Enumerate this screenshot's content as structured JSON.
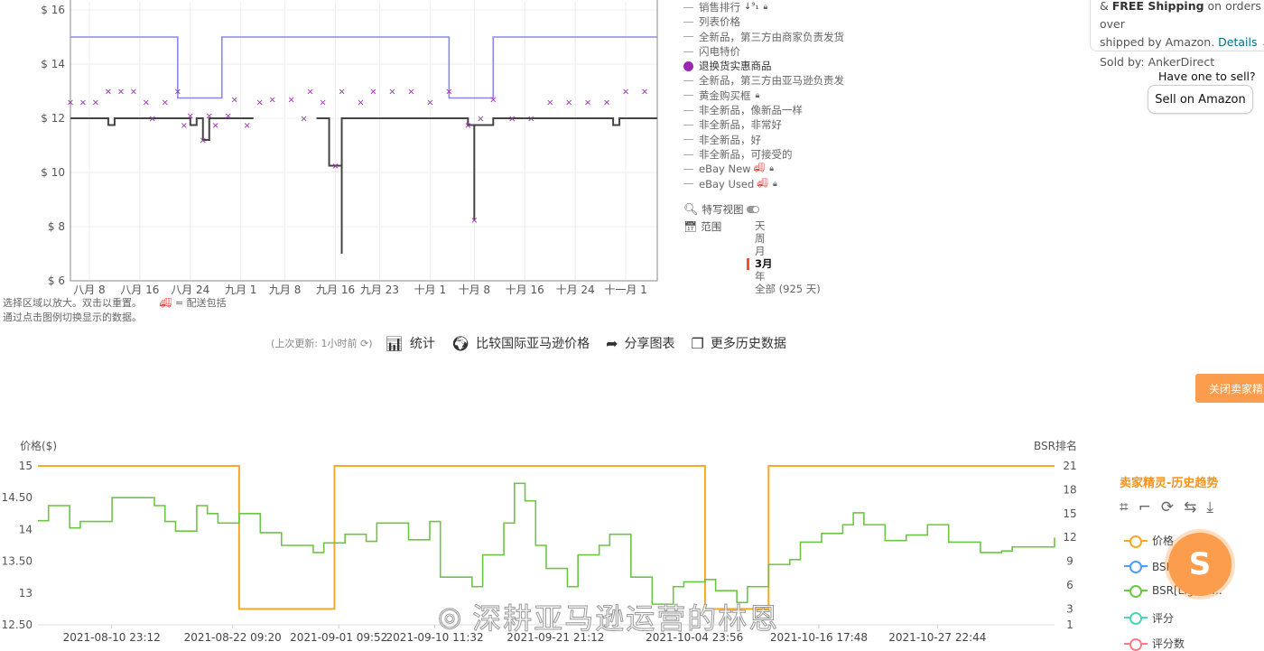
{
  "top_chart": {
    "y_ticks": [
      "$ 16",
      "$ 14",
      "$ 12",
      "$ 10",
      "$ 8",
      "$ 6"
    ],
    "y_values": [
      16,
      14,
      12,
      10,
      8,
      6
    ],
    "x_ticks": [
      {
        "label": "八月 8",
        "date": "2021-08-08"
      },
      {
        "label": "八月 16",
        "date": "2021-08-16"
      },
      {
        "label": "八月 24",
        "date": "2021-08-24"
      },
      {
        "label": "九月 1",
        "date": "2021-09-01"
      },
      {
        "label": "九月 8",
        "date": "2021-09-08"
      },
      {
        "label": "九月 16",
        "date": "2021-09-16"
      },
      {
        "label": "九月 23",
        "date": "2021-09-23"
      },
      {
        "label": "十月 1",
        "date": "2021-10-01"
      },
      {
        "label": "十月 8",
        "date": "2021-10-08"
      },
      {
        "label": "十月 16",
        "date": "2021-10-16"
      },
      {
        "label": "十月 24",
        "date": "2021-10-24"
      },
      {
        "label": "十一月 1",
        "date": "2021-11-01"
      }
    ],
    "x_range": [
      "2021-08-05",
      "2021-11-06"
    ],
    "y_range": [
      6,
      16.3
    ],
    "colors": {
      "list_price": "#8888ee",
      "amazon": "#444444",
      "warehouse": "#9c27b0"
    }
  },
  "chart_data": [
    {
      "type": "line",
      "xlabel": "",
      "ylabel": "",
      "ylim": [
        6,
        16.3
      ],
      "series": [
        {
          "name": "列表价格",
          "step": true,
          "points": [
            [
              "2021-08-05",
              15
            ],
            [
              "2021-08-22",
              12.75
            ],
            [
              "2021-08-29",
              15
            ],
            [
              "2021-10-04",
              12.75
            ],
            [
              "2021-10-11",
              15
            ],
            [
              "2021-11-06",
              15
            ]
          ]
        },
        {
          "step": true,
          "points": [
            [
              "2021-08-05",
              12
            ],
            [
              "2021-08-11",
              11.75
            ],
            [
              "2021-08-12",
              12
            ],
            [
              "2021-08-24",
              11.75
            ],
            [
              "2021-08-25",
              12
            ],
            [
              "2021-08-26",
              11.2
            ],
            [
              "2021-08-27",
              12
            ],
            [
              "2021-09-03",
              12
            ],
            [
              "2021-09-13",
              null
            ],
            [
              "2021-09-13",
              12
            ],
            [
              "2021-09-15",
              10.25
            ],
            [
              "2021-09-17",
              7
            ],
            [
              "2021-09-17",
              12
            ],
            [
              "2021-09-20",
              12
            ],
            [
              "2021-10-06",
              12
            ],
            [
              "2021-10-07",
              11.75
            ],
            [
              "2021-10-08",
              8.25
            ],
            [
              "2021-10-08",
              11.75
            ],
            [
              "2021-10-11",
              12
            ],
            [
              "2021-10-29",
              12
            ],
            [
              "2021-10-30",
              11.75
            ],
            [
              "2021-10-31",
              12
            ],
            [
              "2021-11-06",
              12
            ]
          ]
        },
        {
          "name": "退换货实惠商品",
          "marker": "x",
          "points": [
            [
              "2021-08-05",
              12.6
            ],
            [
              "2021-08-07",
              12.6
            ],
            [
              "2021-08-09",
              12.6
            ],
            [
              "2021-08-11",
              13
            ],
            [
              "2021-08-13",
              13
            ],
            [
              "2021-08-15",
              13
            ],
            [
              "2021-08-17",
              12.6
            ],
            [
              "2021-08-18",
              12
            ],
            [
              "2021-08-20",
              12.6
            ],
            [
              "2021-08-22",
              13
            ],
            [
              "2021-08-23",
              11.75
            ],
            [
              "2021-08-24",
              12.1
            ],
            [
              "2021-08-26",
              11.2
            ],
            [
              "2021-08-27",
              12.1
            ],
            [
              "2021-08-28",
              11.75
            ],
            [
              "2021-08-30",
              12.1
            ],
            [
              "2021-08-31",
              12.7
            ],
            [
              "2021-09-02",
              11.75
            ],
            [
              "2021-09-04",
              12.6
            ],
            [
              "2021-09-06",
              12.7
            ],
            [
              "2021-09-09",
              12.7
            ],
            [
              "2021-09-11",
              12
            ],
            [
              "2021-09-12",
              13
            ],
            [
              "2021-09-14",
              12.6
            ],
            [
              "2021-09-16",
              10.25
            ],
            [
              "2021-09-17",
              13
            ],
            [
              "2021-09-20",
              12.6
            ],
            [
              "2021-09-22",
              13
            ],
            [
              "2021-09-25",
              13
            ],
            [
              "2021-09-28",
              13
            ],
            [
              "2021-10-01",
              12.6
            ],
            [
              "2021-10-04",
              13
            ],
            [
              "2021-10-07",
              11.75
            ],
            [
              "2021-10-08",
              8.25
            ],
            [
              "2021-10-09",
              12
            ],
            [
              "2021-10-11",
              12.7
            ],
            [
              "2021-10-14",
              12
            ],
            [
              "2021-10-17",
              12
            ],
            [
              "2021-10-20",
              12.6
            ],
            [
              "2021-10-23",
              12.6
            ],
            [
              "2021-10-26",
              12.6
            ],
            [
              "2021-10-29",
              12.6
            ],
            [
              "2021-11-01",
              13
            ],
            [
              "2021-11-04",
              13
            ]
          ]
        }
      ]
    },
    {
      "type": "line",
      "ylabel": "价格($)",
      "y2label": "BSR排名",
      "ylim": [
        12.5,
        15
      ],
      "y_ticks": [
        "15",
        "14.50",
        "14",
        "13.50",
        "13",
        "12.50"
      ],
      "y_tick_values": [
        15,
        14.5,
        14,
        13.5,
        13,
        12.5
      ],
      "y2_ticks": [
        "21",
        "18",
        "15",
        "12",
        "9",
        "6",
        "3",
        "1"
      ],
      "y2_tick_values": [
        21,
        18,
        15,
        12,
        9,
        6,
        3,
        1
      ],
      "y2lim": [
        1,
        21
      ],
      "x_range": [
        "2021-08-04",
        "2021-11-08"
      ],
      "x_ticks": [
        {
          "label": "2021-08-10 23:12",
          "date": "2021-08-10T23:12"
        },
        {
          "label": "2021-08-22 09:20",
          "date": "2021-08-22T09:20"
        },
        {
          "label": "2021-09-01 09:52",
          "date": "2021-09-01T09:52"
        },
        {
          "label": "2021-09-10 11:32",
          "date": "2021-09-10T11:32"
        },
        {
          "label": "2021-09-21 21:12",
          "date": "2021-09-21T21:12"
        },
        {
          "label": "2021-10-04 23:56",
          "date": "2021-10-04T23:56"
        },
        {
          "label": "2021-10-16 17:48",
          "date": "2021-10-16T17:48"
        },
        {
          "label": "2021-10-27 22:44",
          "date": "2021-10-27T22:44"
        }
      ],
      "series": [
        {
          "name": "价格",
          "color": "#f9a825",
          "axis": "left",
          "step": true,
          "points": [
            [
              "2021-08-04",
              15
            ],
            [
              "2021-08-23",
              12.75
            ],
            [
              "2021-09-01",
              15
            ],
            [
              "2021-10-06",
              12.75
            ],
            [
              "2021-10-12",
              15
            ],
            [
              "2021-11-08",
              15
            ]
          ]
        },
        {
          "name": "BSR[Lightn...",
          "color": "#6cc644",
          "axis": "right",
          "step": true,
          "points": [
            [
              "2021-08-04",
              14.1
            ],
            [
              "2021-08-05",
              16
            ],
            [
              "2021-08-07",
              13.2
            ],
            [
              "2021-08-08",
              14
            ],
            [
              "2021-08-11",
              17
            ],
            [
              "2021-08-13",
              17
            ],
            [
              "2021-08-15",
              16
            ],
            [
              "2021-08-16",
              14
            ],
            [
              "2021-08-17",
              12.8
            ],
            [
              "2021-08-19",
              16
            ],
            [
              "2021-08-20",
              15
            ],
            [
              "2021-08-21",
              13.8
            ],
            [
              "2021-08-23",
              15
            ],
            [
              "2021-08-25",
              12.6
            ],
            [
              "2021-08-27",
              11
            ],
            [
              "2021-08-30",
              10.1
            ],
            [
              "2021-08-31",
              11.3
            ],
            [
              "2021-09-02",
              12.4
            ],
            [
              "2021-09-04",
              11.5
            ],
            [
              "2021-09-05",
              13.8
            ],
            [
              "2021-09-08",
              11.7
            ],
            [
              "2021-09-10",
              14
            ],
            [
              "2021-09-11",
              7
            ],
            [
              "2021-09-14",
              5.8
            ],
            [
              "2021-09-15",
              9.8
            ],
            [
              "2021-09-17",
              13.8
            ],
            [
              "2021-09-18",
              18.8
            ],
            [
              "2021-09-19",
              16.6
            ],
            [
              "2021-09-20",
              11
            ],
            [
              "2021-09-21",
              8.1
            ],
            [
              "2021-09-23",
              5.8
            ],
            [
              "2021-09-24",
              9.8
            ],
            [
              "2021-09-26",
              11
            ],
            [
              "2021-09-27",
              12.4
            ],
            [
              "2021-09-29",
              7
            ],
            [
              "2021-10-01",
              3.6
            ],
            [
              "2021-10-03",
              5.8
            ],
            [
              "2021-10-04",
              6.4
            ],
            [
              "2021-10-06",
              6.7
            ],
            [
              "2021-10-07",
              5.3
            ],
            [
              "2021-10-09",
              3.8
            ],
            [
              "2021-10-10",
              5.8
            ],
            [
              "2021-10-12",
              8.6
            ],
            [
              "2021-10-14",
              9.2
            ],
            [
              "2021-10-15",
              11.4
            ],
            [
              "2021-10-17",
              12.5
            ],
            [
              "2021-10-19",
              13.6
            ],
            [
              "2021-10-20",
              15.1
            ],
            [
              "2021-10-21",
              13.6
            ],
            [
              "2021-10-23",
              11.6
            ],
            [
              "2021-10-25",
              12.3
            ],
            [
              "2021-10-27",
              13.6
            ],
            [
              "2021-10-29",
              11.4
            ],
            [
              "2021-11-01",
              10.1
            ],
            [
              "2021-11-03",
              10.3
            ],
            [
              "2021-11-04",
              10.8
            ],
            [
              "2021-11-06",
              10.8
            ],
            [
              "2021-11-08",
              12
            ]
          ]
        }
      ]
    }
  ],
  "legend": {
    "items": [
      {
        "label": "销售排行",
        "extra": "↓⁹₁",
        "lock": true,
        "style": "dash"
      },
      {
        "label": "列表价格",
        "style": "dash"
      },
      {
        "label": "全新品，第三方由商家负责发货",
        "style": "dash"
      },
      {
        "label": "闪电特价",
        "style": "dash"
      },
      {
        "label": "退换货实惠商品",
        "style": "dot",
        "active": true
      },
      {
        "label": "全新品，第三方由亚马逊负责发",
        "style": "dash"
      },
      {
        "label": "黄金购买框",
        "lock": true,
        "style": "dash"
      },
      {
        "label": "非全新品，像新品一样",
        "style": "dash"
      },
      {
        "label": "非全新品，非常好",
        "style": "dash"
      },
      {
        "label": "非全新品，好",
        "style": "dash"
      },
      {
        "label": "非全新品，可接受的",
        "style": "dash"
      },
      {
        "label": "eBay New",
        "truck": true,
        "lock": true,
        "style": "dash"
      },
      {
        "label": "eBay Used",
        "truck": true,
        "lock": true,
        "style": "dash"
      }
    ],
    "closeup_label": "特写视图",
    "range_label": "范围",
    "ranges": [
      "天",
      "周",
      "月",
      "3月",
      "年",
      "全部 (925 天)"
    ],
    "selected_range": "3月"
  },
  "notes": {
    "line1": "选择区域以放大。双击以重置。",
    "shipping": "= 配送包括",
    "line2": "通过点击图例切换显示的数据。"
  },
  "toolbar": {
    "updated": "(上次更新:  1小时前",
    "stats": "统计",
    "compare": "比较国际亚马逊价格",
    "share": "分享图表",
    "more": "更多历史数据"
  },
  "buybox": {
    "shipping_prefix": "& ",
    "shipping_bold": "FREE Shipping",
    "shipping_rest": " on orders over",
    "shipped_by": "shipped by Amazon.",
    "details": "Details",
    "sold_by": "Sold by: AnkerDirect",
    "have_one": "Have one to sell?",
    "sell_button": "Sell on Amazon"
  },
  "sellersprite": {
    "close_button": "关闭卖家精灵",
    "title": "卖家精灵-历史趋势",
    "tool_icons": [
      "crop-icon",
      "crop-back-icon",
      "refresh-icon",
      "swap-icon",
      "download-icon"
    ],
    "legend": [
      {
        "label": "价格",
        "color": "#f9a825"
      },
      {
        "label": "BSR排",
        "color": "#4a9eff"
      },
      {
        "label": "BSR[Lightn...",
        "color": "#6cc644"
      },
      {
        "label": "评分",
        "color": "#4ad6b8"
      },
      {
        "label": "评分数",
        "color": "#ff7a8a"
      }
    ],
    "fab_letter": "S"
  },
  "watermark": "深耕亚马逊运营的林恩"
}
